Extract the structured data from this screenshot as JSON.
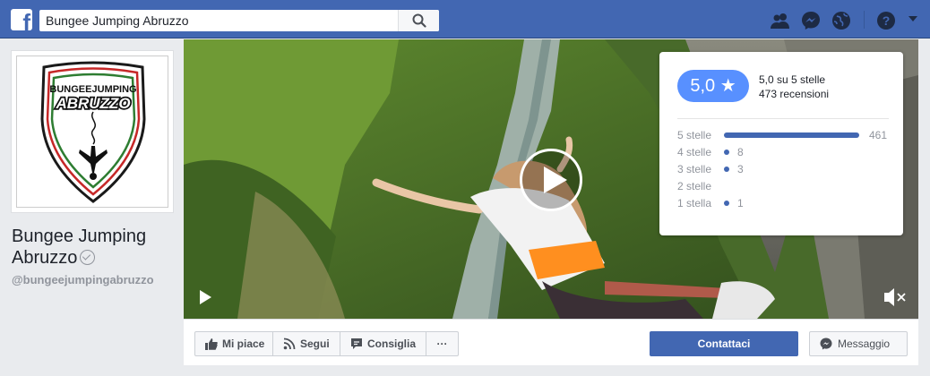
{
  "topbar": {
    "logo_letter": "f",
    "search": {
      "value": "Bungee Jumping Abruzzo",
      "placeholder": ""
    },
    "icons": [
      "friends-icon",
      "messenger-icon",
      "globe-icon",
      "help-icon",
      "caret-down-icon"
    ],
    "color": "#4267b2"
  },
  "profile": {
    "logo_line1": "BUNGEEJUMPING",
    "logo_line2": "ABRUZZO",
    "name": "Bungee Jumping Abruzzo",
    "handle": "@bungeejumpingabruzzo",
    "verified": true
  },
  "cover": {
    "type": "video",
    "controls": [
      "play-icon",
      "mute-icon"
    ]
  },
  "ratings": {
    "score": "5,0 ★",
    "summary": "5,0 su 5 stelle",
    "reviews": "473 recensioni",
    "rows": [
      {
        "label": "5 stelle",
        "count": "461",
        "fraction": 0.975
      },
      {
        "label": "4 stelle",
        "count": "8",
        "fraction": 0.017
      },
      {
        "label": "3 stelle",
        "count": "3",
        "fraction": 0.006
      },
      {
        "label": "2 stelle",
        "count": "",
        "fraction": 0
      },
      {
        "label": "1 stella",
        "count": "1",
        "fraction": 0.002
      }
    ],
    "bar_color": "#4267b2",
    "pill_color": "#5890ff"
  },
  "actions": {
    "like": "Mi piace",
    "follow": "Segui",
    "recommend": "Consiglia",
    "more": "···",
    "contact": "Contattaci",
    "message": "Messaggio"
  }
}
